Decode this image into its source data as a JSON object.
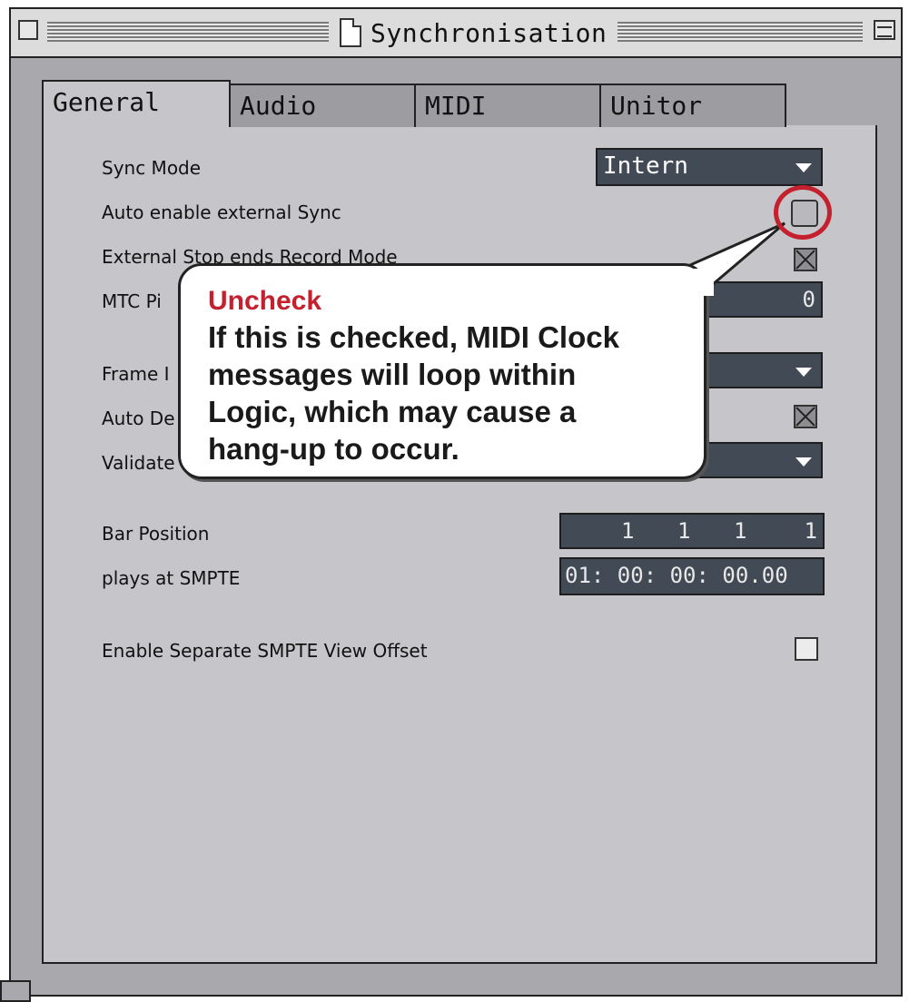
{
  "window": {
    "title": "Synchronisation"
  },
  "tabs": [
    {
      "label": "General",
      "active": true
    },
    {
      "label": "Audio",
      "active": false
    },
    {
      "label": "MIDI",
      "active": false
    },
    {
      "label": "Unitor",
      "active": false
    }
  ],
  "general": {
    "sync_mode": {
      "label": "Sync Mode",
      "value": "Intern"
    },
    "auto_enable_external_sync": {
      "label": "Auto enable external Sync",
      "checked": false
    },
    "external_stop_ends_record": {
      "label": "External Stop ends Record Mode",
      "checked": true
    },
    "mtc_pickup": {
      "label_visible": "MTC Pi",
      "value": "0"
    },
    "frame_rate": {
      "label_visible": "Frame I"
    },
    "auto_detect": {
      "label_visible": "Auto De",
      "checked": true
    },
    "validate": {
      "label_visible": "Validate"
    },
    "bar_position": {
      "label": "Bar Position",
      "values": [
        "1",
        "1",
        "1",
        "1"
      ]
    },
    "plays_at_smpte": {
      "label": "plays at SMPTE",
      "value": "01: 00: 00: 00.00"
    },
    "separate_smpte_offset": {
      "label": "Enable Separate SMPTE View Offset",
      "checked": false
    }
  },
  "callout": {
    "title": "Uncheck",
    "lines": [
      "If this is checked, MIDI Clock",
      "messages will loop within",
      "Logic, which may cause a",
      "hang-up to occur."
    ],
    "accent": "#c4202e"
  },
  "colors": {
    "window_bg": "#a9a9ad",
    "panel_bg": "#c6c6ca",
    "field_bg": "#424a55"
  }
}
